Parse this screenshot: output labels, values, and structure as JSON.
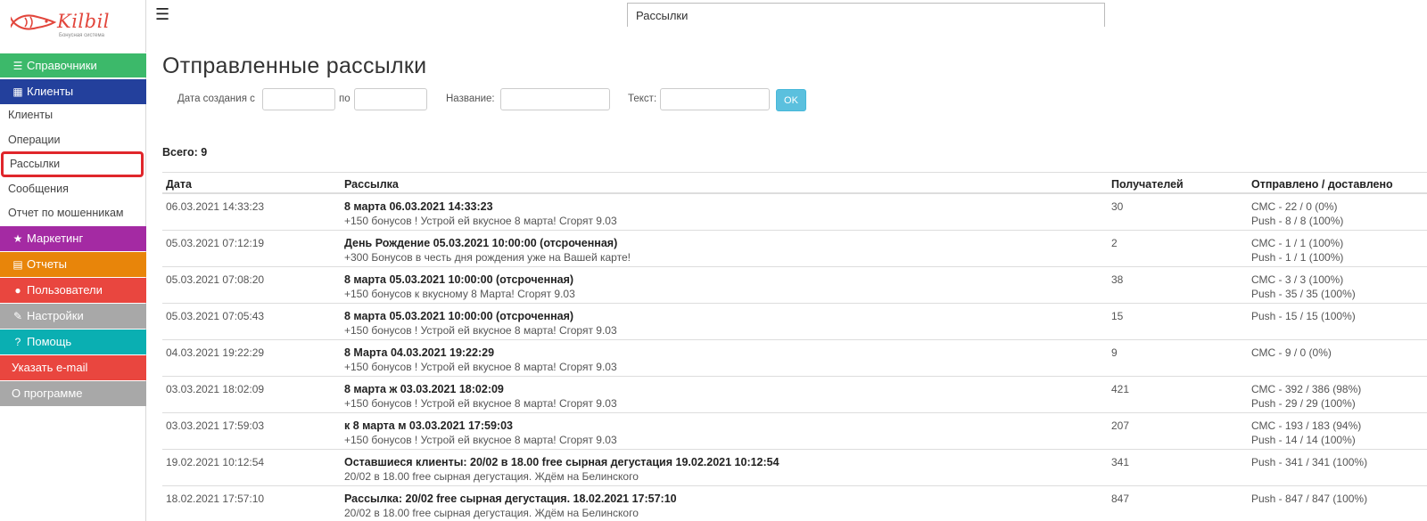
{
  "logo": {
    "text": "Kilbil",
    "subtitle": "Бонусная система"
  },
  "colors": {
    "green": "#3cb96a",
    "blue": "#23409c",
    "purple": "#a42aa3",
    "orange": "#e8850a",
    "red": "#e9463f",
    "gray": "#a8a8a8",
    "teal": "#0aafb2",
    "ok": "#5bc0de"
  },
  "sidebar": {
    "sections": [
      {
        "label": "Справочники",
        "icon": "list-icon",
        "glyph": "☰",
        "color": "#3cb96a"
      },
      {
        "label": "Клиенты",
        "icon": "grid-icon",
        "glyph": "▦",
        "color": "#23409c"
      },
      {
        "label": "Маркетинг",
        "icon": "star-icon",
        "glyph": "★",
        "color": "#a42aa3"
      },
      {
        "label": "Отчеты",
        "icon": "report-icon",
        "glyph": "▤",
        "color": "#e8850a"
      },
      {
        "label": "Пользователи",
        "icon": "user-icon",
        "glyph": "●",
        "color": "#e9463f"
      },
      {
        "label": "Настройки",
        "icon": "wrench-icon",
        "glyph": "✎",
        "color": "#a8a8a8"
      },
      {
        "label": "Помощь",
        "icon": "question-icon",
        "glyph": "?",
        "color": "#0aafb2"
      },
      {
        "label": "Указать e-mail",
        "icon": "",
        "glyph": "",
        "color": "#e9463f"
      },
      {
        "label": "О программе",
        "icon": "",
        "glyph": "",
        "color": "#a8a8a8"
      }
    ],
    "client_links": [
      "Клиенты",
      "Операции",
      "Рассылки",
      "Сообщения",
      "Отчет по мошенникам"
    ],
    "active_link": "Рассылки"
  },
  "search": {
    "value": "Рассылки"
  },
  "page": {
    "title": "Отправленные рассылки",
    "total": "Всего: 9"
  },
  "filters": {
    "date_from_label": "Дата создания с",
    "date_to_label": "по",
    "name_label": "Название:",
    "text_label": "Текст:",
    "ok_label": "OK"
  },
  "table": {
    "headers": {
      "date": "Дата",
      "mailing": "Рассылка",
      "recipients": "Получателей",
      "sent": "Отправлено / доставлено"
    },
    "rows": [
      {
        "date": "06.03.2021 14:33:23",
        "title": "8 марта 06.03.2021 14:33:23",
        "text": "+150 бонусов ! Устрой ей вкусное 8 марта! Сгорят 9.03",
        "recipients": "30",
        "sent": [
          "СМС - 22 / 0 (0%)",
          "Push - 8 / 8 (100%)"
        ]
      },
      {
        "date": "05.03.2021 07:12:19",
        "title": "День Рождение 05.03.2021 10:00:00 (отсроченная)",
        "text": "+300 Бонусов в честь дня рождения уже на Вашей карте!",
        "recipients": "2",
        "sent": [
          "СМС - 1 / 1 (100%)",
          "Push - 1 / 1 (100%)"
        ]
      },
      {
        "date": "05.03.2021 07:08:20",
        "title": "8 марта 05.03.2021 10:00:00 (отсроченная)",
        "text": "+150 бонусов к вкусному 8 Марта! Сгорят 9.03",
        "recipients": "38",
        "sent": [
          "СМС - 3 / 3 (100%)",
          "Push - 35 / 35 (100%)"
        ]
      },
      {
        "date": "05.03.2021 07:05:43",
        "title": "8 марта 05.03.2021 10:00:00 (отсроченная)",
        "text": " +150 бонусов ! Устрой ей вкусное 8 марта! Сгорят 9.03",
        "recipients": "15",
        "sent": [
          "Push - 15 / 15 (100%)"
        ]
      },
      {
        "date": "04.03.2021 19:22:29",
        "title": "8 Марта 04.03.2021 19:22:29",
        "text": " +150 бонусов ! Устрой ей вкусное 8 марта! Сгорят 9.03",
        "recipients": "9",
        "sent": [
          "СМС - 9 / 0 (0%)"
        ]
      },
      {
        "date": "03.03.2021 18:02:09",
        "title": "8 марта ж 03.03.2021 18:02:09",
        "text": " +150 бонусов ! Устрой ей вкусное 8 марта! Сгорят 9.03",
        "recipients": "421",
        "sent": [
          "СМС - 392 / 386 (98%)",
          "Push - 29 / 29 (100%)"
        ]
      },
      {
        "date": "03.03.2021 17:59:03",
        "title": "к 8 марта м 03.03.2021 17:59:03",
        "text": "+150 бонусов ! Устрой ей вкусное 8 марта! Сгорят 9.03",
        "recipients": "207",
        "sent": [
          "СМС - 193 / 183 (94%)",
          "Push - 14 / 14 (100%)"
        ]
      },
      {
        "date": "19.02.2021 10:12:54",
        "title": "Оставшиеся клиенты: 20/02 в 18.00 free сырная дегустация 19.02.2021 10:12:54",
        "text": "20/02 в 18.00 free сырная дегустация. Ждём на Белинского",
        "recipients": "341",
        "sent": [
          "Push - 341 / 341 (100%)"
        ]
      },
      {
        "date": "18.02.2021 17:57:10",
        "title": "Рассылка: 20/02 free сырная дегустация. 18.02.2021 17:57:10",
        "text": "20/02 в 18.00 free сырная дегустация. Ждём на Белинского",
        "recipients": "847",
        "sent": [
          "Push - 847 / 847 (100%)"
        ]
      }
    ]
  }
}
